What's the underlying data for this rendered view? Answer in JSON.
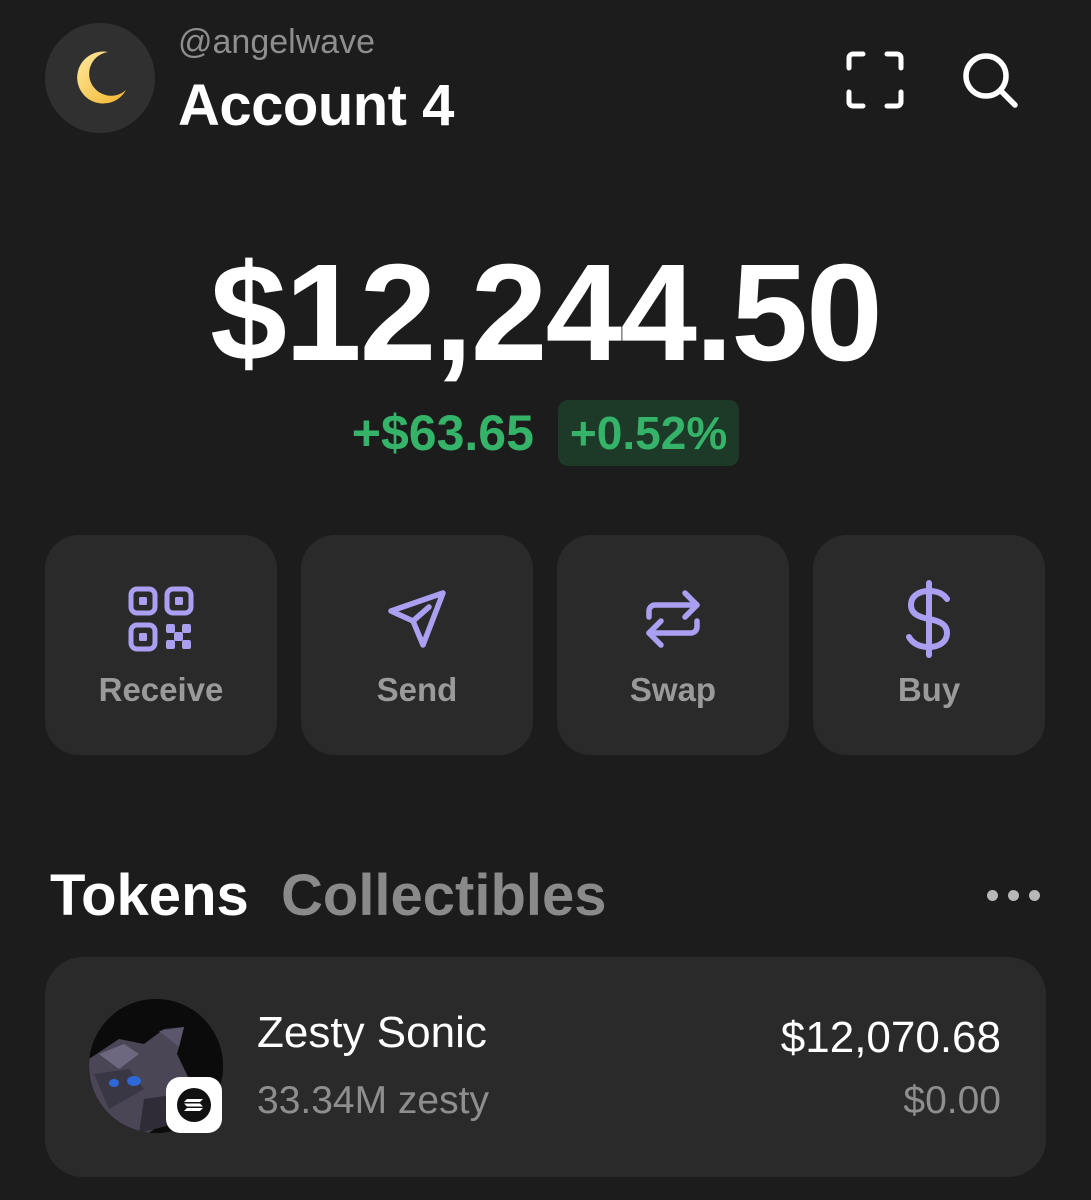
{
  "account": {
    "handle": "@angelwave",
    "name": "Account 4",
    "avatar_icon": "crescent-moon-icon"
  },
  "header": {
    "scan_icon": "scan-frame-icon",
    "search_icon": "search-icon"
  },
  "balance": {
    "total": "$12,244.50",
    "change_abs": "+$63.65",
    "change_pct": "+0.52%",
    "positive_color": "#34b369"
  },
  "actions": [
    {
      "label": "Receive",
      "icon": "qr-code-icon"
    },
    {
      "label": "Send",
      "icon": "send-arrow-icon"
    },
    {
      "label": "Swap",
      "icon": "swap-arrows-icon"
    },
    {
      "label": "Buy",
      "icon": "dollar-sign-icon"
    }
  ],
  "accent_color": "#ab9ff2",
  "tabs": [
    {
      "label": "Tokens",
      "active": true
    },
    {
      "label": "Collectibles",
      "active": false
    }
  ],
  "more_icon": "more-horizontal-icon",
  "tokens": [
    {
      "name": "Zesty Sonic",
      "quantity": "33.34M zesty",
      "value": "$12,070.68",
      "change": "$0.00",
      "chain_icon": "solana-icon"
    }
  ]
}
